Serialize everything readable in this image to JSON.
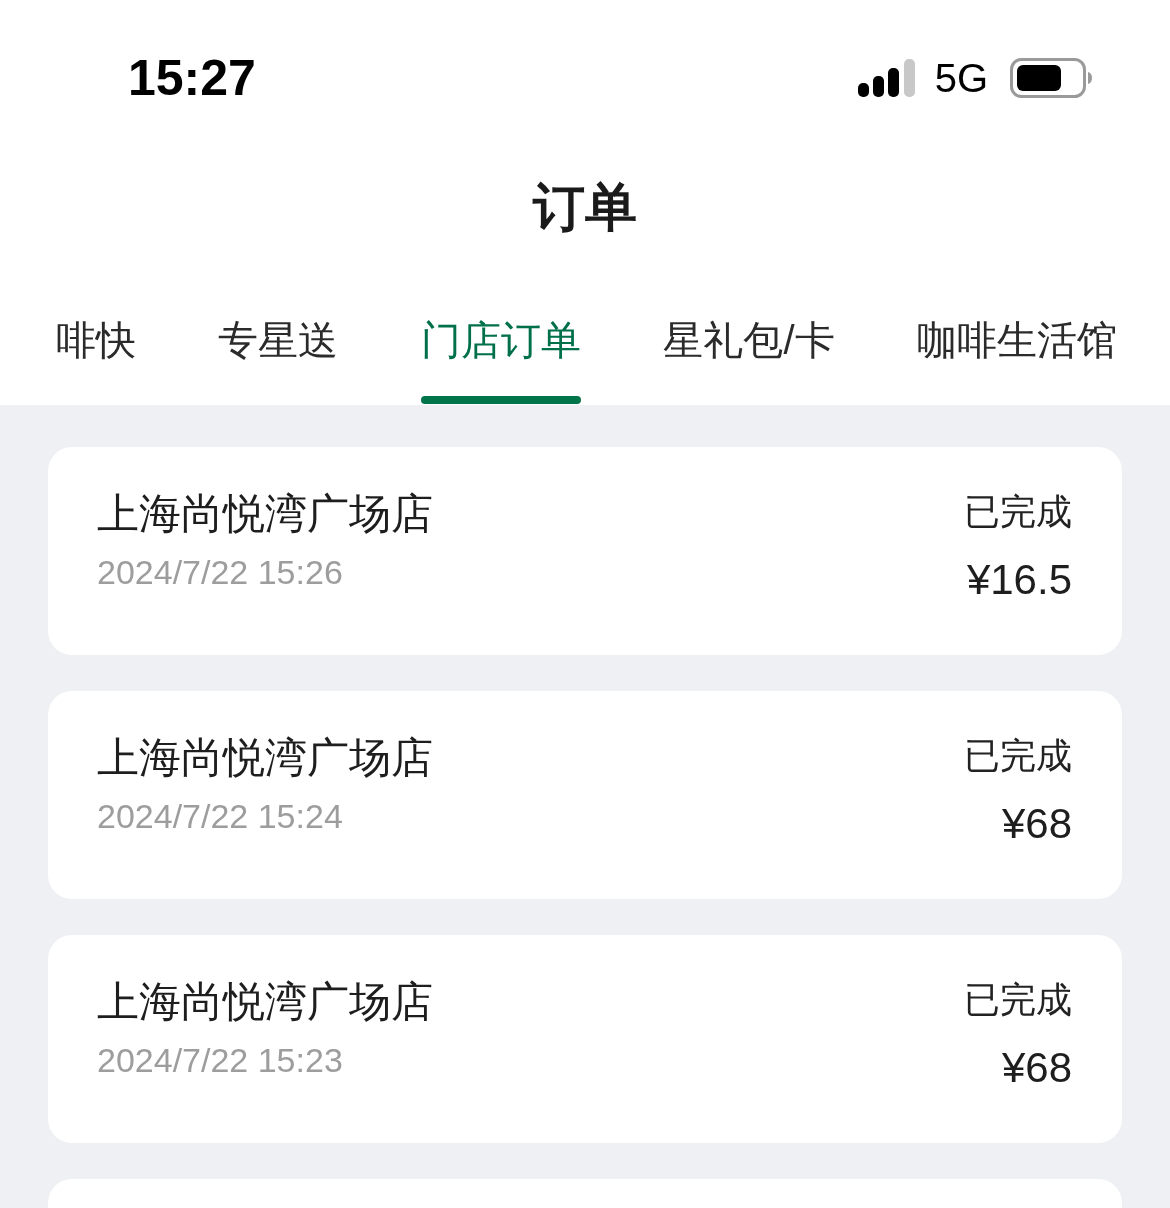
{
  "status_bar": {
    "time": "15:27",
    "network": "5G"
  },
  "header": {
    "title": "订单"
  },
  "tabs": [
    {
      "label": "啡快",
      "selected": false
    },
    {
      "label": "专星送",
      "selected": false
    },
    {
      "label": "门店订单",
      "selected": true
    },
    {
      "label": "星礼包/卡",
      "selected": false
    },
    {
      "label": "咖啡生活馆",
      "selected": false
    }
  ],
  "orders": [
    {
      "store": "上海尚悦湾广场店",
      "date": "2024/7/22 15:26",
      "status": "已完成",
      "price": "¥16.5"
    },
    {
      "store": "上海尚悦湾广场店",
      "date": "2024/7/22 15:24",
      "status": "已完成",
      "price": "¥68"
    },
    {
      "store": "上海尚悦湾广场店",
      "date": "2024/7/22 15:23",
      "status": "已完成",
      "price": "¥68"
    }
  ],
  "orders_continue_below": true
}
